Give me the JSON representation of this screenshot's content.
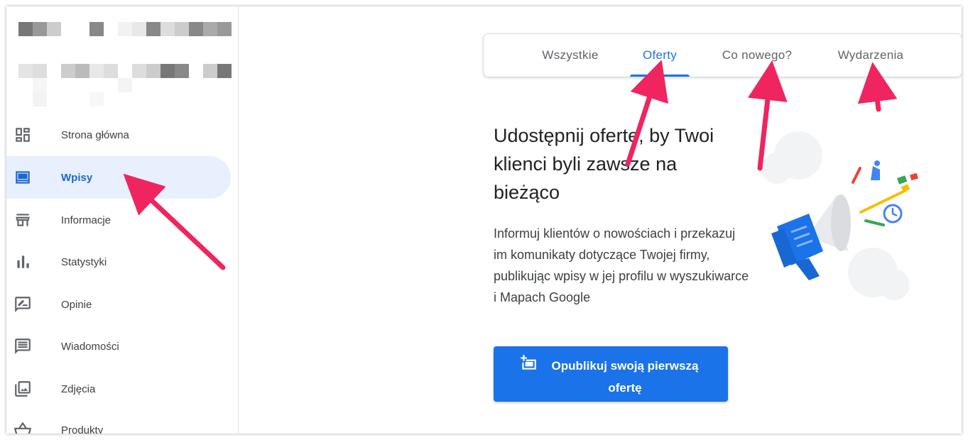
{
  "sidebar": {
    "items": [
      {
        "label": "Strona główna",
        "icon": "dashboard-icon"
      },
      {
        "label": "Wpisy",
        "icon": "posts-icon",
        "active": true
      },
      {
        "label": "Informacje",
        "icon": "store-icon"
      },
      {
        "label": "Statystyki",
        "icon": "bar-chart-icon"
      },
      {
        "label": "Opinie",
        "icon": "rate-review-icon"
      },
      {
        "label": "Wiadomości",
        "icon": "message-icon"
      },
      {
        "label": "Zdjęcia",
        "icon": "photo-library-icon"
      },
      {
        "label": "Produkty",
        "icon": "basket-icon"
      }
    ]
  },
  "tabs": [
    {
      "label": "Wszystkie"
    },
    {
      "label": "Oferty",
      "active": true
    },
    {
      "label": "Co nowego?"
    },
    {
      "label": "Wydarzenia"
    }
  ],
  "main": {
    "headline": "Udostępnij ofertę, by Twoi klienci byli zawsze na bieżąco",
    "body": "Informuj klientów o nowościach i przekazuj im komunikaty dotyczące Twojej firmy, publikując wpisy w jej profilu w wyszukiwarce i Mapach Google",
    "cta_label": "Opublikuj swoją pierwszą ofertę"
  },
  "colors": {
    "accent": "#1a73e8",
    "active_nav_bg": "#e8f0fe",
    "annotation_arrow": "#f0245e"
  }
}
